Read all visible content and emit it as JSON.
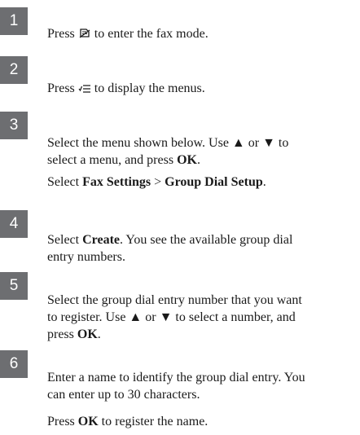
{
  "steps": [
    {
      "number": "1",
      "before": "Press ",
      "icon": "fax-icon",
      "after": " to enter the fax mode."
    },
    {
      "number": "2",
      "before": "Press ",
      "icon": "menu-icon",
      "after": " to display the menus."
    },
    {
      "number": "3",
      "text": "Select the menu shown below. Use ▲ or ▼ to\nselect a menu, and press ",
      "bold": "OK",
      "after": ".",
      "sub_before": "Select ",
      "sub_b1": "Fax Settings",
      "sub_mid": " > ",
      "sub_b2": "Group Dial Setup",
      "sub_after": "."
    },
    {
      "number": "4",
      "before": "Select ",
      "bold": "Create",
      "after": ". You see the available group dial\nentry numbers."
    },
    {
      "number": "5",
      "text": "Select the group dial entry number that you want\nto register. Use ▲ or ▼ to select a number, and\npress ",
      "bold": "OK",
      "after": "."
    },
    {
      "number": "6",
      "text": "Enter a name to identify the group dial entry. You\ncan enter up to 30 characters.",
      "sub_before": "Press ",
      "sub_b1": "OK",
      "sub_after": " to register the name."
    }
  ]
}
